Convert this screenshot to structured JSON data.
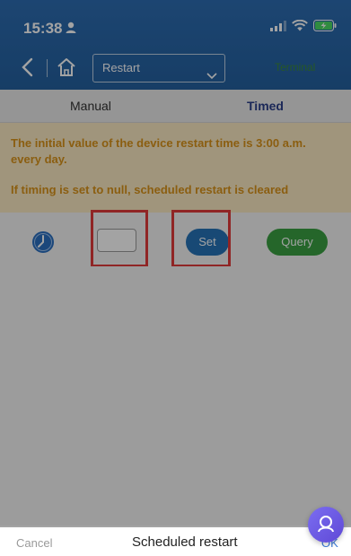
{
  "status_bar": {
    "time": "15:38"
  },
  "nav": {
    "select_value": "Restart",
    "right_link": "Terminal"
  },
  "tabs": [
    {
      "label": "Manual"
    },
    {
      "label": "Timed"
    }
  ],
  "notice": {
    "line1": "The initial value of the device restart time is 3:00 a.m. every day.",
    "line2": "If timing is set to null, scheduled restart is cleared"
  },
  "actions": {
    "set_label": "Set",
    "query_label": "Query",
    "time_value": ""
  },
  "bottom_sheet": {
    "cancel": "Cancel",
    "title": "Scheduled restart",
    "ok": "OK"
  },
  "colors": {
    "header": "#2d6db2",
    "notice_text": "#d9931a",
    "set_button": "#2673b8",
    "query_button": "#3aa043",
    "highlight": "#e23b3b"
  },
  "icons": [
    "person-icon",
    "signal-icon",
    "wifi-icon",
    "battery-icon",
    "back-icon",
    "home-icon",
    "chevron-down-icon",
    "clock-icon",
    "assistant-icon"
  ]
}
